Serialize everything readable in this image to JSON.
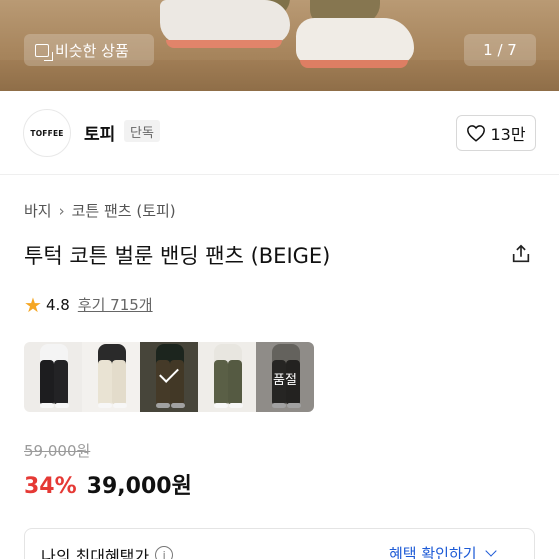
{
  "hero": {
    "similar_button_label": "비슷한 상품",
    "image_counter": "1 / 7"
  },
  "brand": {
    "logo_text": "TOFFEE",
    "name": "토피",
    "badge": "단독",
    "like_count": "13만"
  },
  "breadcrumb": {
    "items": [
      "바지",
      "코튼 팬츠 (토피)"
    ]
  },
  "product": {
    "title": "투턱 코튼 벌룬 밴딩 팬츠 (BEIGE)",
    "rating": "4.8",
    "reviews_label": "후기 715개"
  },
  "options": [
    {
      "color": "black",
      "selected": false,
      "soldout": false
    },
    {
      "color": "beige",
      "selected": false,
      "soldout": false
    },
    {
      "color": "khaki-brown",
      "selected": true,
      "soldout": false
    },
    {
      "color": "olive",
      "selected": false,
      "soldout": false
    },
    {
      "color": "charcoal",
      "selected": false,
      "soldout": true,
      "soldout_label": "품절"
    }
  ],
  "pricing": {
    "original_price": "59,000원",
    "discount": "34%",
    "price": "39,000원"
  },
  "benefit": {
    "label": "나의 최대혜택가",
    "link_label": "혜택 확인하기"
  },
  "colors": {
    "discount": "#e53935",
    "link": "#1e5bd6",
    "star": "#f5a623"
  }
}
